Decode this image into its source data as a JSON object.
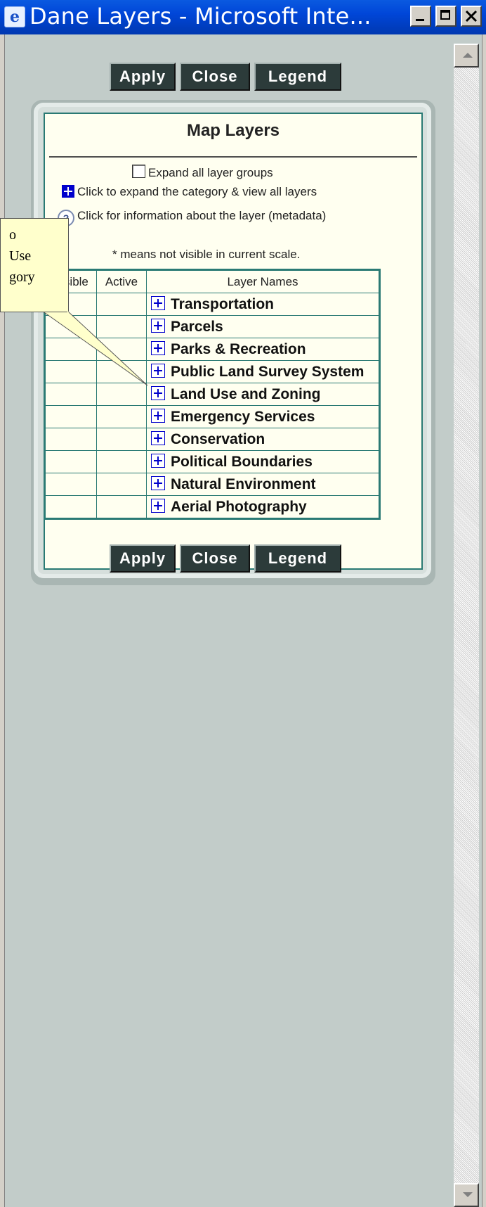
{
  "window": {
    "title": "Dane Layers - Microsoft Inte...",
    "icon": "ie-icon",
    "controls": [
      "minimize",
      "maximize",
      "close"
    ]
  },
  "buttons": {
    "apply": "Apply",
    "close": "Close",
    "legend": "Legend"
  },
  "panel": {
    "title": "Map Layers",
    "expand_all_label": "Expand all layer groups",
    "expand_hint": "Click to expand the category & view all layers",
    "info_hint": "Click for information about the layer (metadata)",
    "scale_note": "* means not visible in current scale."
  },
  "table": {
    "headers": [
      "Visible",
      "Active",
      "Layer Names"
    ],
    "rows": [
      "Transportation",
      "Parcels",
      "Parks & Recreation",
      "Public Land Survey System",
      "Land Use and Zoning",
      "Emergency Services",
      "Conservation",
      "Political Boundaries",
      "Natural Environment",
      "Aerial Photography"
    ]
  },
  "callout": {
    "lines": [
      "o",
      "Use",
      "gory"
    ]
  },
  "colors": {
    "title_bar": "#0046d8",
    "button_bg": "#2c3b3a",
    "table_border": "#2a7a74",
    "page_bg": "#c2ccc9",
    "callout_bg": "#ffffcc",
    "plus_icon": "#0000cc"
  }
}
